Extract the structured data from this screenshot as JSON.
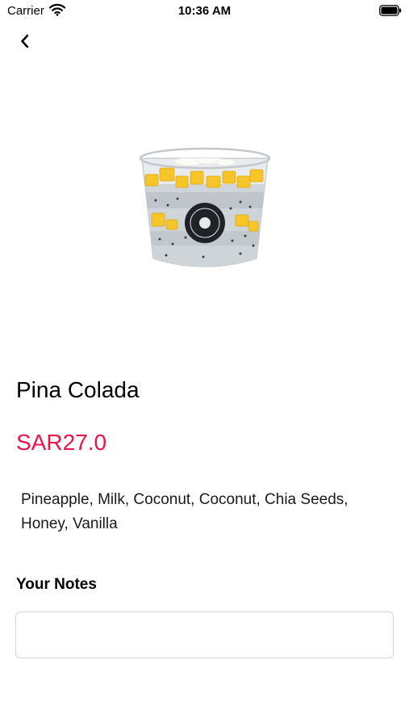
{
  "status_bar": {
    "carrier": "Carrier",
    "time": "10:36 AM",
    "wifi_icon": "wifi-icon",
    "battery_icon": "battery-icon"
  },
  "nav": {
    "back_icon": "chevron-left-icon"
  },
  "product": {
    "name": "Pina Colada",
    "price": "SAR27.0",
    "ingredients": "Pineapple, Milk, Coconut, Coconut, Chia Seeds, Honey, Vanilla",
    "image": "chia-pudding-cup-image"
  },
  "notes": {
    "label": "Your Notes",
    "value": "",
    "placeholder": ""
  },
  "colors": {
    "price": "#e8154b",
    "background": "#ffffff"
  }
}
